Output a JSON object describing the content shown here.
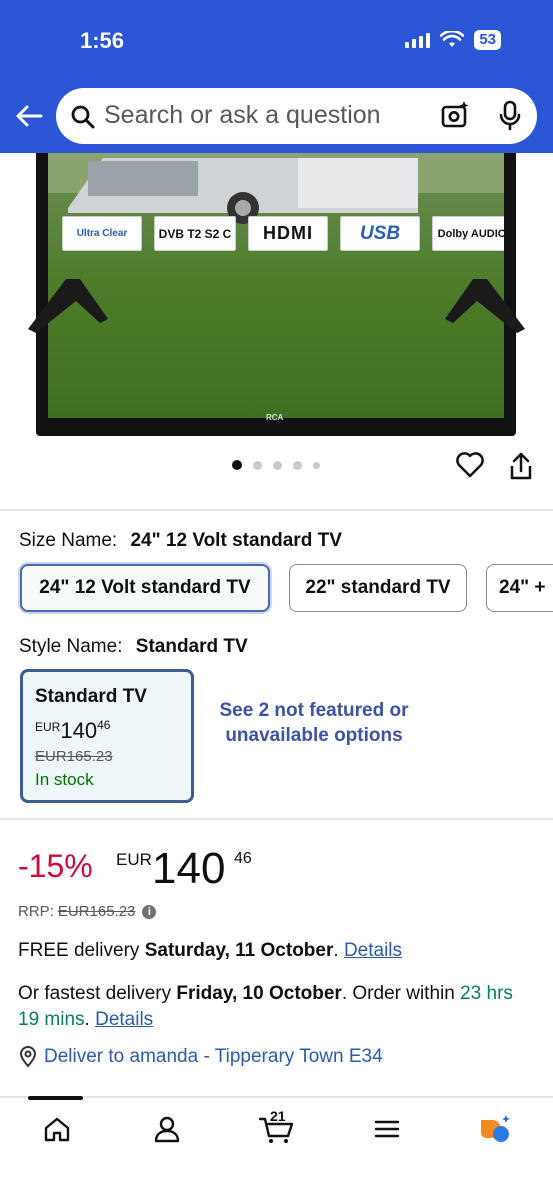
{
  "status": {
    "time": "1:56",
    "battery": "53"
  },
  "search": {
    "placeholder": "Search or ask a question"
  },
  "product_image": {
    "logos": [
      "Ultra Clear",
      "DVB T2 S2 C",
      "HDMI",
      "USB",
      "Dolby AUDIO"
    ],
    "tv_brand": "RCA",
    "carousel_total": 5,
    "carousel_active": 1
  },
  "size": {
    "label": "Size Name:",
    "selected_value": "24\" 12 Volt standard TV",
    "options": [
      "24\" 12 Volt standard TV",
      "22\" standard TV",
      "24\" +"
    ]
  },
  "style": {
    "label": "Style Name:",
    "selected_value": "Standard TV",
    "card": {
      "title": "Standard TV",
      "currency": "EUR",
      "price_whole": "140",
      "price_fraction": "46",
      "old_price": "EUR165.23",
      "stock": "In stock"
    },
    "not_featured": "See 2 not featured or unavailable options"
  },
  "price": {
    "discount": "-15%",
    "currency": "EUR",
    "whole": "140",
    "fraction": "46",
    "rrp_label": "RRP:",
    "rrp_value": "EUR165.23"
  },
  "delivery": {
    "free_prefix": "FREE delivery",
    "free_date": "Saturday, 11 October",
    "details": "Details",
    "fastest_prefix": "Or fastest delivery",
    "fastest_date": "Friday, 10 October",
    "order_within": "Order within",
    "countdown": "23 hrs 19 mins",
    "deliver_to": "Deliver to amanda - Tipperary Town E34"
  },
  "nav": {
    "cart_count": "21"
  },
  "colors": {
    "header": "#2a56d6",
    "discount": "#cc0c39",
    "link": "#2a5ca8",
    "stock": "#007600"
  }
}
